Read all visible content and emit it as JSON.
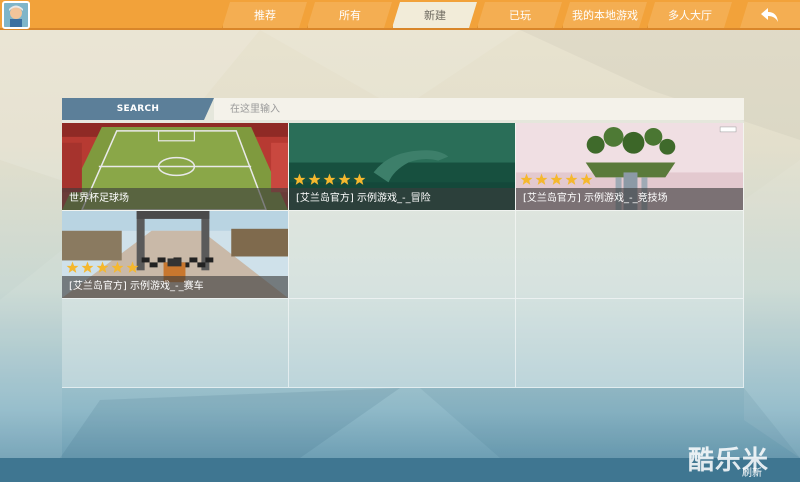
{
  "header": {
    "tabs": [
      {
        "label": "推荐",
        "active": false
      },
      {
        "label": "所有",
        "active": false
      },
      {
        "label": "新建",
        "active": true
      },
      {
        "label": "已玩",
        "active": false
      },
      {
        "label": "我的本地游戏",
        "active": false
      },
      {
        "label": "多人大厅",
        "active": false
      }
    ],
    "back_icon": "back-arrow-icon",
    "avatar_icon": "avatar"
  },
  "search": {
    "label": "SEARCH",
    "placeholder": "在这里输入"
  },
  "games": [
    {
      "title": "世界杯足球场",
      "stars": 0
    },
    {
      "title": "[艾兰岛官方] 示例游戏_-_冒险",
      "stars": 5
    },
    {
      "title": "[艾兰岛官方] 示例游戏_-_竞技场",
      "stars": 5
    },
    {
      "title": "[艾兰岛官方] 示例游戏_-_赛车",
      "stars": 5
    }
  ],
  "footer": {
    "refresh_label": "刷新",
    "watermark": "酷乐米"
  },
  "colors": {
    "topbar": "#f2a23a",
    "active_tab": "#f2ecd9",
    "search_label_bg": "#5c7f99",
    "bottombar": "#3f7691",
    "star": "#f5b82e"
  }
}
